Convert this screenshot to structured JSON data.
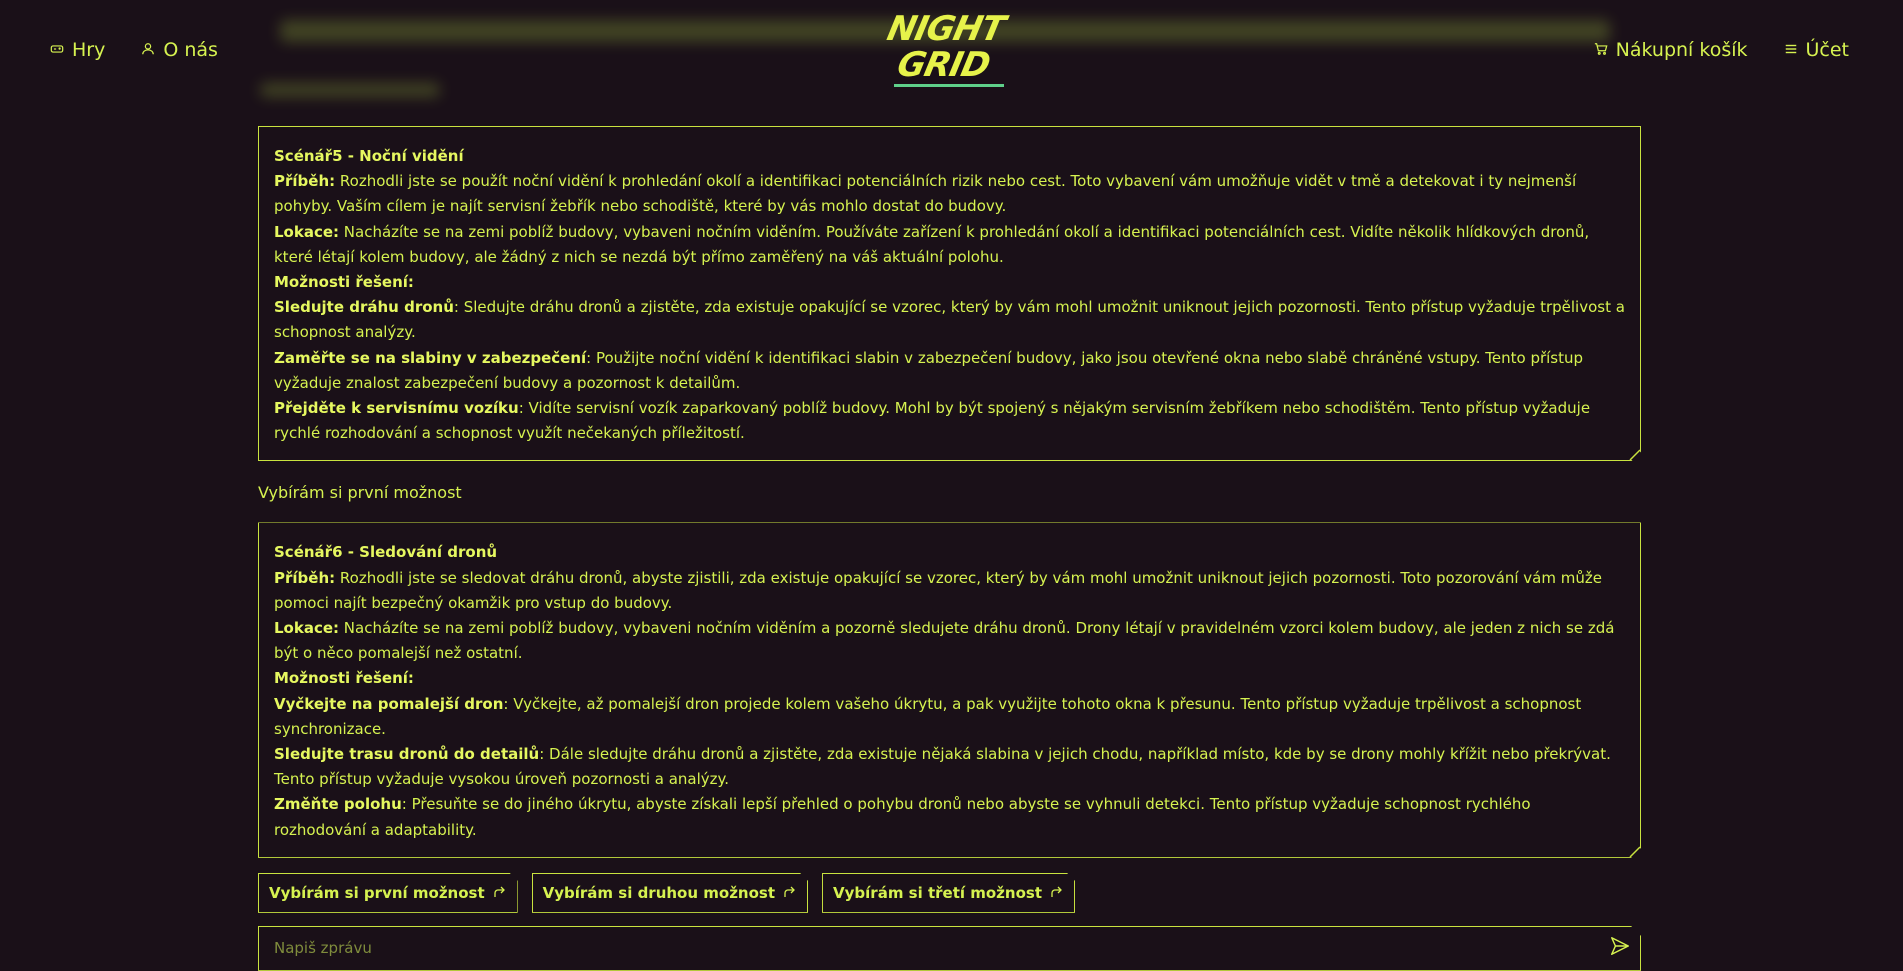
{
  "header": {
    "nav_left": [
      {
        "label": "Hry",
        "icon": "gamepad-icon"
      },
      {
        "label": "O nás",
        "icon": "user-icon"
      }
    ],
    "nav_right": [
      {
        "label": "Nákupní košík",
        "icon": "cart-icon"
      },
      {
        "label": "Účet",
        "icon": "menu-icon"
      }
    ],
    "logo": {
      "line1": "NIGHT",
      "line2": "GRID"
    }
  },
  "chat": {
    "scenario5": {
      "title": "Scénář5 - Noční vidění",
      "story_label": "Příběh:",
      "story": " Rozhodli jste se použít noční vidění k prohledání okolí a identifikaci potenciálních rizik nebo cest. Toto vybavení vám umožňuje vidět v tmě a detekovat i ty nejmenší pohyby. Vaším cílem je najít servisní žebřík nebo schodiště, které by vás mohlo dostat do budovy.",
      "location_label": "Lokace:",
      "location": " Nacházíte se na zemi poblíž budovy, vybaveni nočním viděním. Používáte zařízení k prohledání okolí a identifikaci potenciálních cest. Vidíte několik hlídkových dronů, které létají kolem budovy, ale žádný z nich se nezdá být přímo zaměřený na váš aktuální polohu.",
      "options_label": "Možnosti řešení:",
      "options": [
        {
          "label": "Sledujte dráhu dronů",
          "text": ": Sledujte dráhu dronů a zjistěte, zda existuje opakující se vzorec, který by vám mohl umožnit uniknout jejich pozornosti. Tento přístup vyžaduje trpělivost a schopnost analýzy."
        },
        {
          "label": "Zaměřte se na slabiny v zabezpečení",
          "text": ": Použijte noční vidění k identifikaci slabin v zabezpečení budovy, jako jsou otevřené okna nebo slabě chráněné vstupy. Tento přístup vyžaduje znalost zabezpečení budovy a pozornost k detailům."
        },
        {
          "label": "Přejděte k servisnímu vozíku",
          "text": ": Vidíte servisní vozík zaparkovaný poblíž budovy. Mohl by být spojený s nějakým servisním žebříkem nebo schodištěm. Tento přístup vyžaduje rychlé rozhodování a schopnost využít nečekaných příležitostí."
        }
      ]
    },
    "user_message": "Vybírám si první možnost",
    "scenario6": {
      "title": "Scénář6 - Sledování dronů",
      "story_label": "Příběh:",
      "story": " Rozhodli jste se sledovat dráhu dronů, abyste zjistili, zda existuje opakující se vzorec, který by vám mohl umožnit uniknout jejich pozornosti. Toto pozorování vám může pomoci najít bezpečný okamžik pro vstup do budovy.",
      "location_label": "Lokace:",
      "location": " Nacházíte se na zemi poblíž budovy, vybaveni nočním viděním a pozorně sledujete dráhu dronů. Drony létají v pravidelném vzorci kolem budovy, ale jeden z nich se zdá být o něco pomalejší než ostatní.",
      "options_label": "Možnosti řešení:",
      "options": [
        {
          "label": "Vyčkejte na pomalejší dron",
          "text": ": Vyčkejte, až pomalejší dron projede kolem vašeho úkrytu, a pak využijte tohoto okna k přesunu. Tento přístup vyžaduje trpělivost a schopnost synchronizace."
        },
        {
          "label": "Sledujte trasu dronů do detailů",
          "text": ": Dále sledujte dráhu dronů a zjistěte, zda existuje nějaká slabina v jejich chodu, například místo, kde by se drony mohly křížit nebo překrývat. Tento přístup vyžaduje vysokou úroveň pozornosti a analýzy."
        },
        {
          "label": "Změňte polohu",
          "text": ": Přesuňte se do jiného úkrytu, abyste získali lepší přehled o pohybu dronů nebo abyste se vyhnuli detekci. Tento přístup vyžaduje schopnost rychlého rozhodování a adaptability."
        }
      ]
    },
    "choice_buttons": [
      "Vybírám si první možnost",
      "Vybírám si druhou možnost",
      "Vybírám si třetí možnost"
    ],
    "input": {
      "placeholder": "Napiš zprávu",
      "value": ""
    }
  },
  "colors": {
    "background": "#1a1018",
    "accent": "#d6f250",
    "border": "#c9e33f"
  }
}
